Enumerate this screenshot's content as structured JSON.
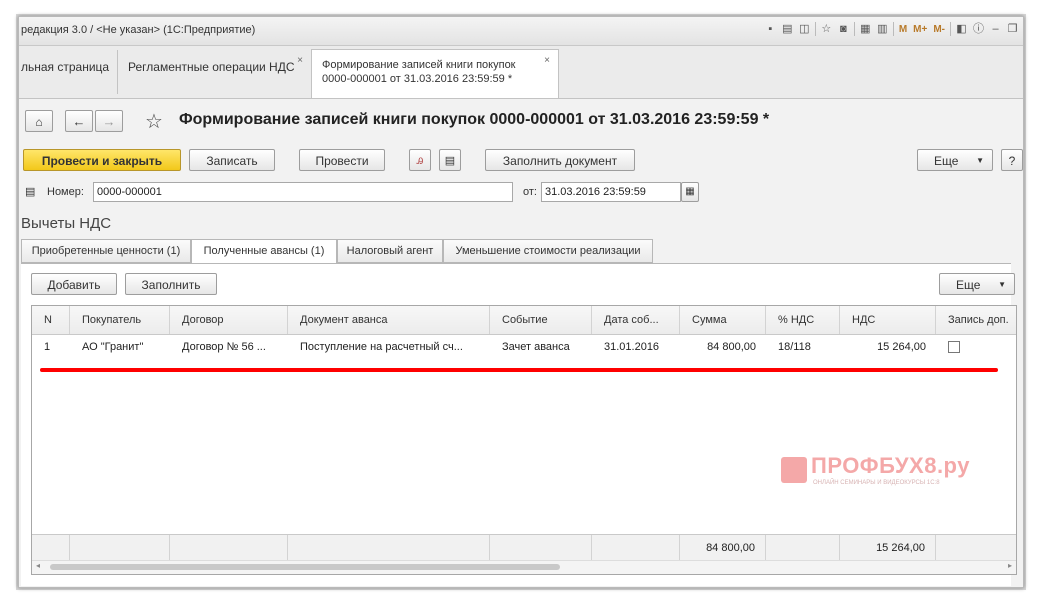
{
  "window": {
    "title": "редакция 3.0 / <Не указан> (1С:Предприятие)",
    "tb_letters": [
      "M",
      "M+",
      "M-"
    ]
  },
  "tabs": [
    {
      "label": "льная страница"
    },
    {
      "label": "Регламентные операции НДС",
      "close": "×"
    },
    {
      "label_line1": "Формирование записей книги покупок",
      "label_line2": "0000-000001 от 31.03.2016 23:59:59 *",
      "close": "×"
    }
  ],
  "form": {
    "title": "Формирование записей книги покупок 0000-000001 от 31.03.2016 23:59:59 *",
    "buttons": {
      "post_close": "Провести и закрыть",
      "save": "Записать",
      "post": "Провести",
      "fill_doc": "Заполнить документ",
      "more": "Еще",
      "help": "?"
    },
    "number_label": "Номер:",
    "number_value": "0000-000001",
    "date_label": "от:",
    "date_value": "31.03.2016 23:59:59",
    "section_title": "Вычеты НДС",
    "tabs": [
      "Приобретенные ценности (1)",
      "Полученные авансы (1)",
      "Налоговый агент",
      "Уменьшение стоимости реализации"
    ],
    "table_buttons": {
      "add": "Добавить",
      "fill": "Заполнить",
      "more": "Еще"
    }
  },
  "table": {
    "columns": [
      "N",
      "Покупатель",
      "Договор",
      "Документ аванса",
      "Событие",
      "Дата соб...",
      "Сумма",
      "% НДС",
      "НДС",
      "Запись доп."
    ],
    "rows": [
      [
        "1",
        "АО \"Гранит\"",
        "Договор № 56 ...",
        "Поступление на расчетный сч...",
        "Зачет аванса",
        "31.01.2016",
        "84 800,00",
        "18/118",
        "15 264,00"
      ]
    ],
    "totals": {
      "sum": "84 800,00",
      "vat": "15 264,00"
    }
  },
  "watermark": {
    "name": "ПРОФБУХ8.ру",
    "sub": "ОНЛАЙН СЕМИНАРЫ И ВИДЕОКУРСЫ 1С:8"
  }
}
